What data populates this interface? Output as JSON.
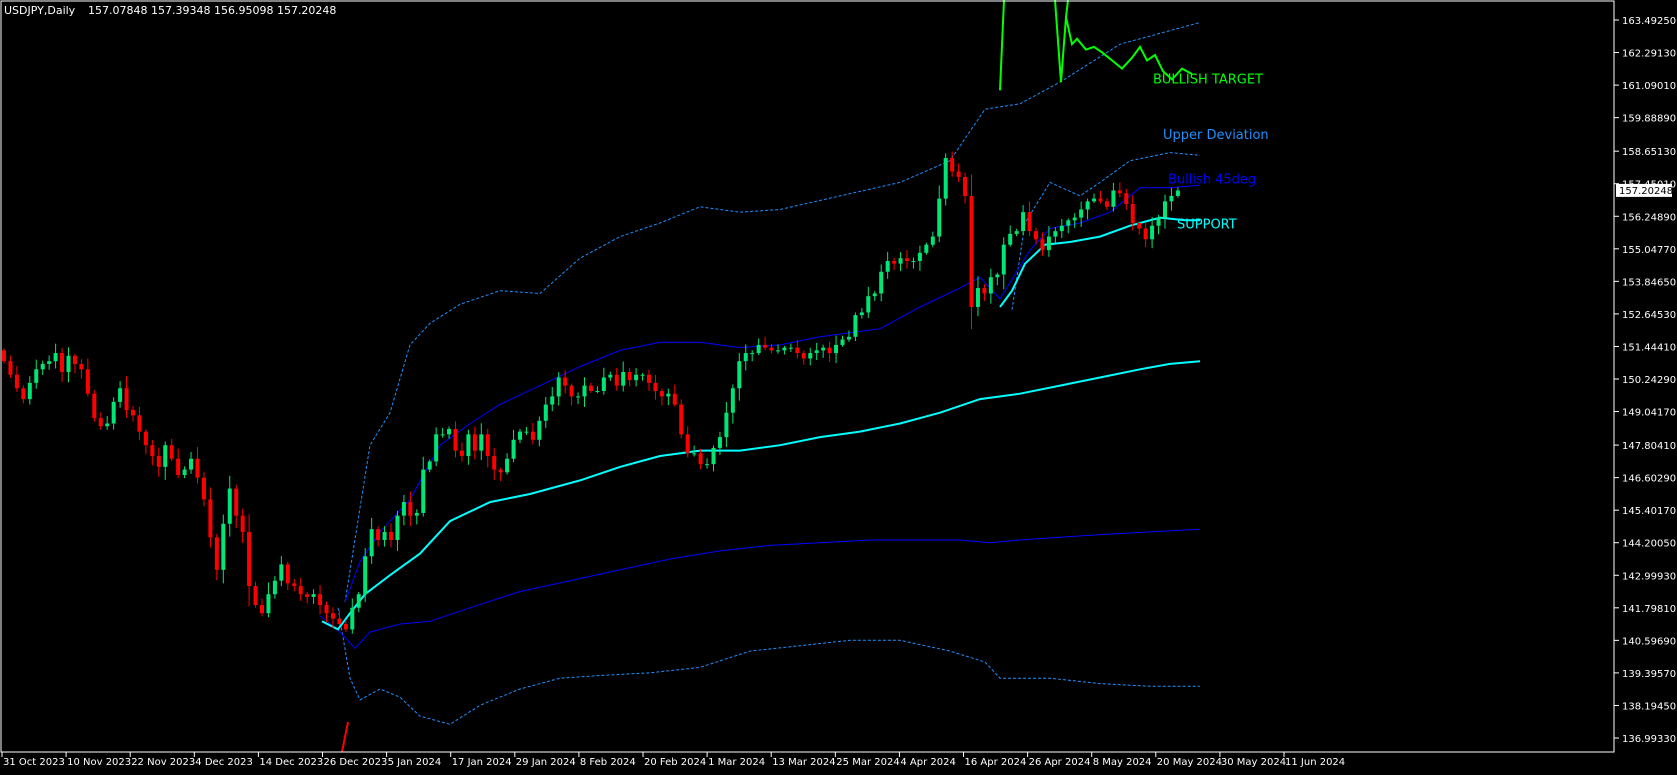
{
  "header": {
    "symbol": "USDJPY,Daily",
    "ohlc": "157.07848 157.39348 156.95098 157.20248"
  },
  "colors": {
    "background": "#000000",
    "frame": "#FFFFFF",
    "bull_candle": "#00E676",
    "bear_candle": "#FF0000",
    "ma_fast": "#00FFFF",
    "channel_blue": "#0000FF",
    "deviation_dashed": "#1E90FF",
    "target_line": "#00FF00",
    "price_tag_bg": "#FFFFFF",
    "price_tag_text": "#000000"
  },
  "chart_data": {
    "type": "candlestick",
    "y_range": [
      136.99,
      164.2
    ],
    "y_ticks": [
      "163.49250",
      "162.29130",
      "161.09010",
      "159.88890",
      "158.65130",
      "157.45010",
      "156.24890",
      "155.04770",
      "153.84650",
      "152.64530",
      "151.44410",
      "150.24290",
      "149.04170",
      "147.80410",
      "146.60290",
      "145.40170",
      "144.20050",
      "142.99930",
      "141.79810",
      "140.59690",
      "139.39570",
      "138.19450",
      "136.99330"
    ],
    "x_ticks": [
      "31 Oct 2023",
      "10 Nov 2023",
      "22 Nov 2023",
      "4 Dec 2023",
      "14 Dec 2023",
      "26 Dec 2023",
      "5 Jan 2024",
      "17 Jan 2024",
      "29 Jan 2024",
      "8 Feb 2024",
      "20 Feb 2024",
      "1 Mar 2024",
      "13 Mar 2024",
      "25 Mar 2024",
      "4 Apr 2024",
      "16 Apr 2024",
      "26 Apr 2024",
      "8 May 2024",
      "20 May 2024",
      "30 May 2024",
      "11 Jun 2024"
    ],
    "current_price": "157.20248",
    "closes": [
      150.9,
      150.4,
      149.9,
      149.5,
      150.1,
      150.6,
      150.8,
      150.9,
      151.2,
      150.5,
      151.1,
      150.8,
      150.6,
      149.7,
      148.8,
      148.5,
      148.6,
      149.4,
      149.9,
      149.1,
      148.9,
      148.3,
      147.8,
      147.4,
      147.0,
      147.8,
      147.3,
      146.7,
      146.9,
      147.3,
      146.6,
      145.8,
      144.4,
      143.2,
      144.9,
      146.2,
      145.2,
      144.6,
      142.6,
      141.9,
      141.6,
      142.3,
      142.8,
      143.4,
      142.7,
      142.6,
      142.3,
      142.2,
      142.3,
      141.9,
      141.6,
      141.4,
      141.2,
      141.0,
      141.8,
      142.3,
      143.7,
      144.7,
      144.3,
      144.6,
      144.3,
      145.2,
      145.7,
      145.2,
      145.3,
      146.9,
      147.2,
      148.2,
      148.2,
      148.4,
      147.6,
      147.4,
      148.2,
      147.6,
      148.2,
      147.4,
      146.9,
      146.8,
      147.3,
      148.0,
      148.3,
      148.3,
      148.0,
      148.7,
      149.3,
      149.6,
      150.3,
      150.0,
      149.6,
      149.6,
      150.0,
      149.8,
      149.8,
      150.3,
      150.4,
      150.0,
      150.5,
      150.2,
      150.4,
      150.4,
      150.1,
      149.8,
      149.6,
      149.7,
      149.3,
      148.2,
      147.5,
      147.5,
      147.1,
      147.1,
      147.7,
      148.1,
      149.0,
      149.9,
      150.9,
      151.2,
      151.2,
      151.5,
      151.4,
      151.3,
      151.3,
      151.4,
      151.4,
      151.2,
      151.0,
      151.2,
      151.3,
      151.4,
      151.2,
      151.5,
      151.7,
      151.8,
      152.6,
      152.7,
      153.3,
      153.4,
      154.2,
      154.6,
      154.5,
      154.7,
      154.6,
      154.6,
      154.9,
      155.2,
      155.5,
      156.9,
      158.4,
      157.9,
      157.7,
      157.0,
      152.9,
      153.6,
      153.4,
      154.0,
      154.1,
      155.2,
      155.6,
      155.7,
      156.4,
      155.7,
      155.4,
      155.0,
      155.5,
      155.7,
      155.9,
      156.1,
      156.2,
      156.5,
      156.8,
      156.9,
      156.8,
      156.6,
      157.2,
      157.1,
      156.7,
      156.0,
      155.8,
      155.4,
      155.9,
      156.2,
      156.8,
      157.0,
      157.2
    ],
    "lines": [
      {
        "name": "BULLISH TARGET",
        "style": "solid"
      },
      {
        "name": "Upper Deviation",
        "style": "dashed"
      },
      {
        "name": "Bullish 45deg",
        "style": "solid"
      },
      {
        "name": "SUPPORT",
        "style": "solid"
      }
    ]
  }
}
